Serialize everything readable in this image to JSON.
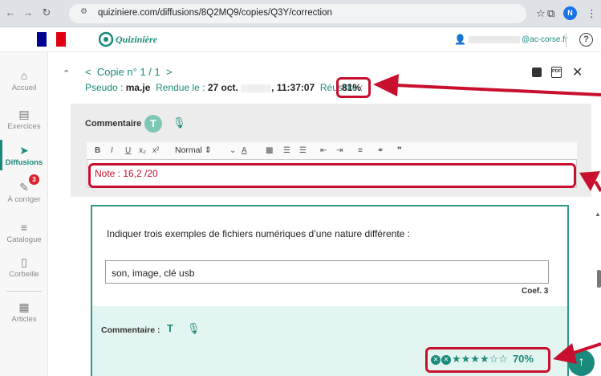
{
  "browser": {
    "url": "quiziniere.com/diffusions/8Q2MQ9/copies/Q3Y/correction",
    "profile_initial": "N"
  },
  "header": {
    "logo_text": "Quizinière",
    "user_email_suffix": "@ac-corse.fr",
    "help": "?"
  },
  "sidebar": {
    "items": [
      {
        "label": "Accueil",
        "icon": "home-icon",
        "glyph": "⌂"
      },
      {
        "label": "Exercices",
        "icon": "file-icon",
        "glyph": "▤"
      },
      {
        "label": "Diffusions",
        "icon": "send-icon",
        "glyph": "➤"
      },
      {
        "label": "À corriger",
        "icon": "edit-icon",
        "glyph": "✎"
      },
      {
        "label": "Catalogue",
        "icon": "list-icon",
        "glyph": "≡"
      },
      {
        "label": "Corbeille",
        "icon": "trash-icon",
        "glyph": "🗑"
      },
      {
        "label": "Articles",
        "icon": "articles-icon",
        "glyph": "▦"
      }
    ],
    "badge_count": "3"
  },
  "copy": {
    "nav_label": "Copie n° 1 / 1",
    "pseudo_label": "Pseudo :",
    "pseudo_value": "ma.je",
    "rendue_label": "Rendue le :",
    "rendue_date": "27 oct.",
    "rendue_time": ", 11:37:07",
    "reussite_label": "Réussite :",
    "reussite_value": "81%"
  },
  "comment": {
    "label": "Commentaire :",
    "avatar_letter": "T",
    "toolbar_format": "Normal",
    "note_text": "Note : 16,2 /20"
  },
  "question": {
    "text": "Indiquer trois exemples de fichiers numériques d’une nature différente :",
    "answer": "son, image, clé usb",
    "coef": "Coef.  3",
    "comment_label": "Commentaire :",
    "t_icon": "T",
    "rating_stars": "★★★★☆☆",
    "rating_percent": "70%"
  },
  "colors": {
    "accent": "#1a8a7c",
    "annotation_red": "#c8102e",
    "badge_red": "#d9232e"
  }
}
